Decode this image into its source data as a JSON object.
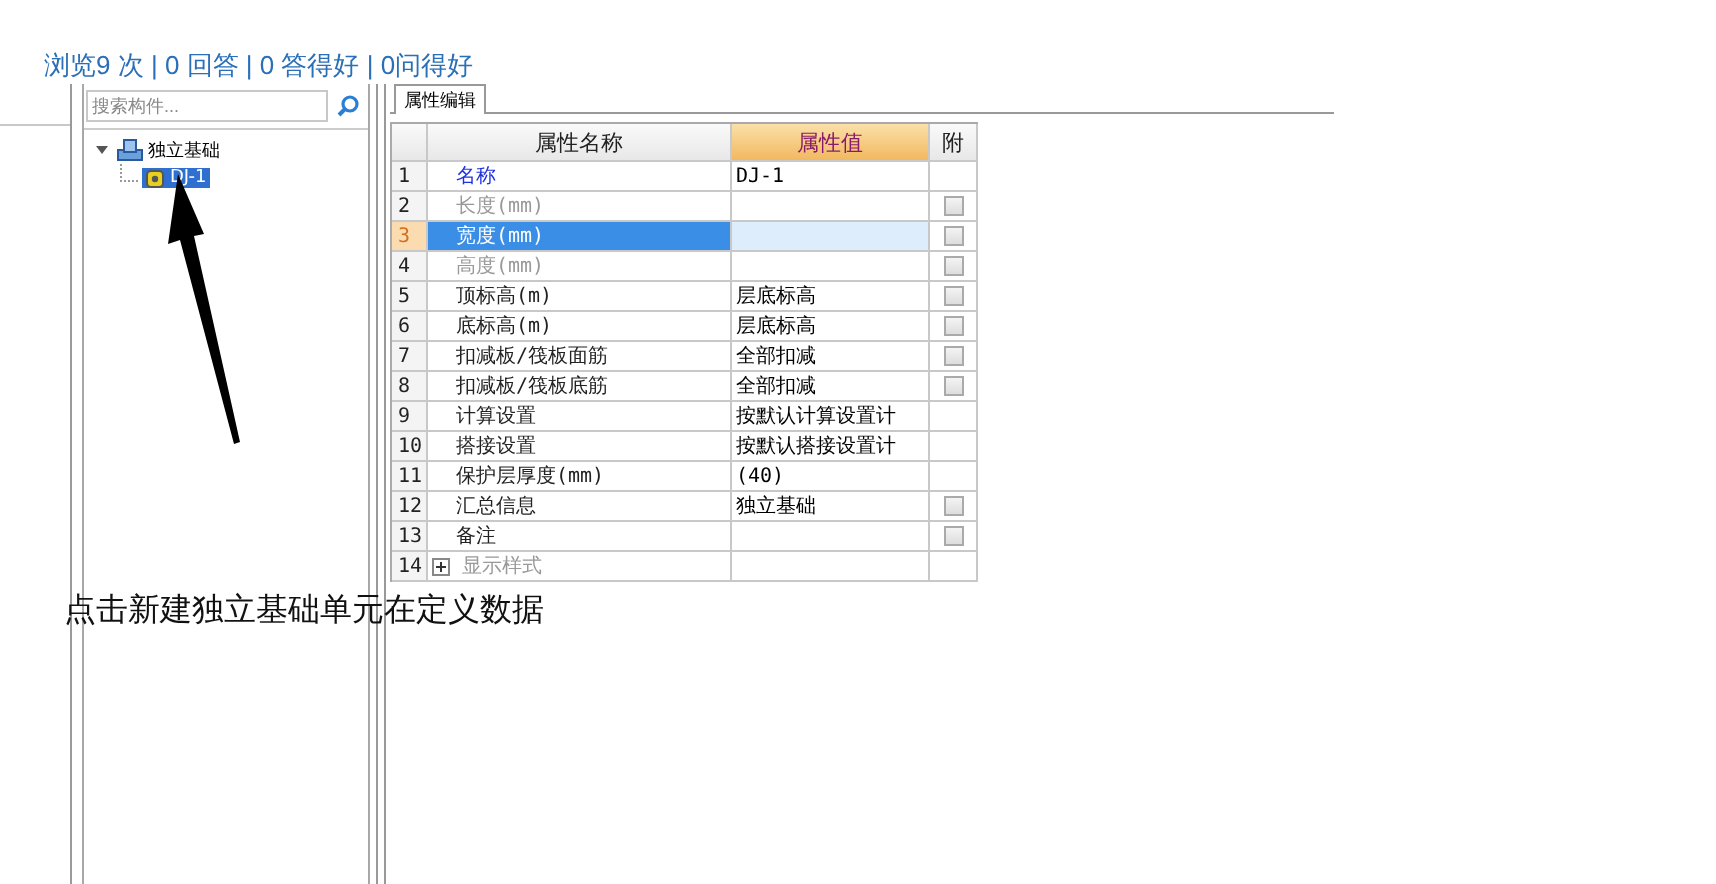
{
  "stats": "浏览9 次 | 0 回答 | 0 答得好 | 0问得好",
  "search": {
    "placeholder": "搜索构件..."
  },
  "tree": [
    {
      "label": "独立基础",
      "expanded": true,
      "selected": false,
      "children": [
        {
          "label": "DJ-1",
          "selected": true
        }
      ]
    }
  ],
  "tab": {
    "label": "属性编辑",
    "selected": true
  },
  "table": {
    "columns": [
      "属性名称",
      "属性值",
      "附"
    ],
    "rows": [
      {
        "number": "1",
        "name": "名称",
        "kind": "key",
        "value": "DJ-1",
        "selected": false
      },
      {
        "number": "2",
        "name": "长度(mm)",
        "kind": "disabled",
        "selected": false,
        "attached": false
      },
      {
        "number": "3",
        "name": "宽度(mm)",
        "kind": "disabled",
        "selected": true,
        "attached": false
      },
      {
        "number": "4",
        "name": "高度(mm)",
        "kind": "disabled",
        "selected": false,
        "attached": false
      },
      {
        "number": "5",
        "name": "顶标高(m)",
        "kind": "normal",
        "value": "层底标高",
        "selected": false,
        "attached": false
      },
      {
        "number": "6",
        "name": "底标高(m)",
        "kind": "normal",
        "value": "层底标高",
        "selected": false,
        "attached": false
      },
      {
        "number": "7",
        "name": "扣减板/筏板面筋",
        "kind": "normal",
        "value": "全部扣减",
        "selected": false,
        "attached": false
      },
      {
        "number": "8",
        "name": "扣减板/筏板底筋",
        "kind": "normal",
        "value": "全部扣减",
        "selected": false,
        "attached": false
      },
      {
        "number": "9",
        "name": "计算设置",
        "kind": "normal",
        "value": "按默认计算设置计",
        "selected": false
      },
      {
        "number": "10",
        "name": "搭接设置",
        "kind": "normal",
        "value": "按默认搭接设置计",
        "selected": false
      },
      {
        "number": "11",
        "name": "保护层厚度(mm)",
        "kind": "normal",
        "value": "(40)",
        "selected": false
      },
      {
        "number": "12",
        "name": "汇总信息",
        "kind": "normal",
        "value": "独立基础",
        "selected": false,
        "attached": false
      },
      {
        "number": "13",
        "name": "备注",
        "kind": "normal",
        "selected": false,
        "attached": false
      },
      {
        "number": "14",
        "name": "显示样式",
        "kind": "disabled",
        "selected": false,
        "expanded": false
      }
    ]
  },
  "caption": "点击新建独立基础单元在定义数据"
}
